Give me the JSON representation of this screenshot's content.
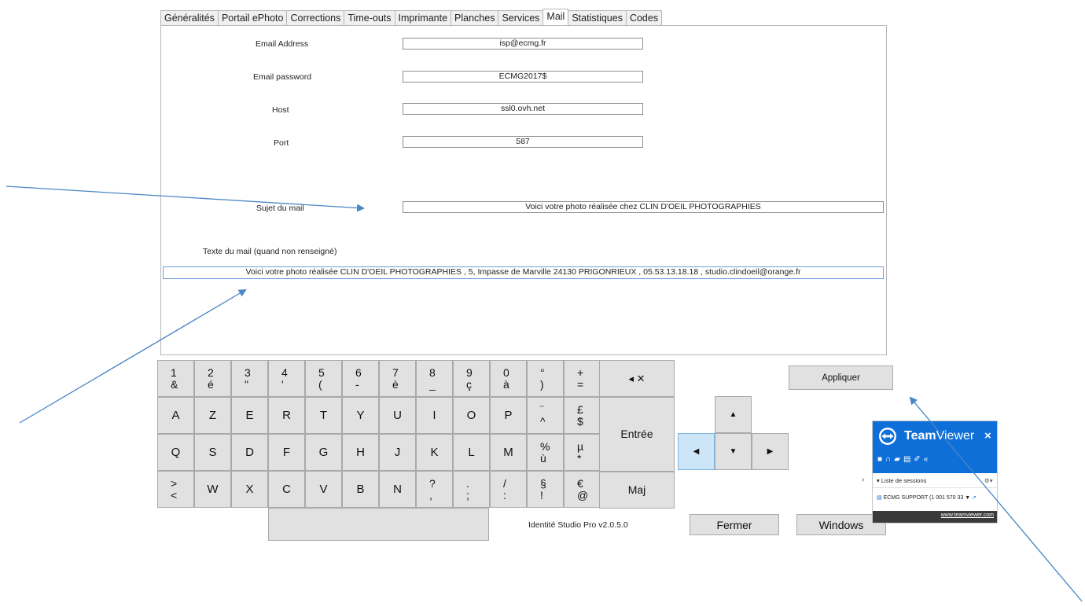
{
  "tabs": [
    {
      "label": "Généralités",
      "width": 80
    },
    {
      "label": "Portail ePhoto",
      "width": 90
    },
    {
      "label": "Corrections",
      "width": 78
    },
    {
      "label": "Time-outs",
      "width": 68
    },
    {
      "label": "Imprimante",
      "width": 76
    },
    {
      "label": "Planches",
      "width": 60
    },
    {
      "label": "Services",
      "width": 61
    },
    {
      "label": "Mail",
      "width": 37,
      "active": true
    },
    {
      "label": "Statistiques",
      "width": 76
    },
    {
      "label": "Codes",
      "width": 44
    }
  ],
  "form": {
    "email_address_label": "Email Address",
    "email_address_value": "isp@ecmg.fr",
    "email_password_label": "Email password",
    "email_password_value": "ECMG2017$",
    "host_label": "Host",
    "host_value": "ssl0.ovh.net",
    "port_label": "Port",
    "port_value": "587",
    "subject_label": "Sujet du mail",
    "subject_value": "Voici votre photo réalisée chez CLIN D'OEIL PHOTOGRAPHIES",
    "body_label": "Texte du mail (quand non renseigné)",
    "body_value": "Voici votre photo réalisée CLIN D'OEIL PHOTOGRAPHIES , 5, Impasse de Marville 24130 PRIGONRIEUX , 05.53.13.18.18 , studio.clindoeil@orange.fr"
  },
  "keyboard": {
    "row1": [
      [
        "1",
        "&"
      ],
      [
        "2",
        "é"
      ],
      [
        "3",
        "\""
      ],
      [
        "4",
        "'"
      ],
      [
        "5",
        "("
      ],
      [
        "6",
        "-"
      ],
      [
        "7",
        "è"
      ],
      [
        "8",
        "_"
      ],
      [
        "9",
        "ç"
      ],
      [
        "0",
        "à"
      ],
      [
        "°",
        ")"
      ],
      [
        "+",
        "="
      ]
    ],
    "row2": [
      "A",
      "Z",
      "E",
      "R",
      "T",
      "Y",
      "U",
      "I",
      "O",
      "P",
      [
        "¨",
        "^"
      ],
      [
        "£",
        "$"
      ]
    ],
    "row3": [
      "Q",
      "S",
      "D",
      "F",
      "G",
      "H",
      "J",
      "K",
      "L",
      "M",
      [
        "%",
        "ù"
      ],
      [
        "µ",
        "*"
      ]
    ],
    "row4": [
      [
        ">",
        "<"
      ],
      "W",
      "X",
      "C",
      "V",
      "B",
      "N",
      [
        "?",
        ","
      ],
      [
        ".",
        ";"
      ],
      [
        "/",
        ":"
      ],
      [
        "§",
        "!"
      ],
      [
        "€",
        "@"
      ]
    ],
    "backspace_label": "◂ ✕",
    "enter_label": "Entrée",
    "shift_label": "Maj"
  },
  "buttons": {
    "apply": "Appliquer",
    "close": "Fermer",
    "windows": "Windows"
  },
  "version": "Identité Studio Pro  v2.0.5.0",
  "teamviewer": {
    "brand_bold": "Team",
    "brand_light": "Viewer",
    "close": "×",
    "sessions_label": "Liste de sessions",
    "session_item": "ECMG SUPPORT (1 001 570 33",
    "url": "www.teamviewer.com",
    "accent": "#0e6fd8"
  },
  "colors": {
    "arrow": "#4a86c5",
    "key_bg": "#e1e1e1",
    "nav_active": "#cce6f7"
  }
}
